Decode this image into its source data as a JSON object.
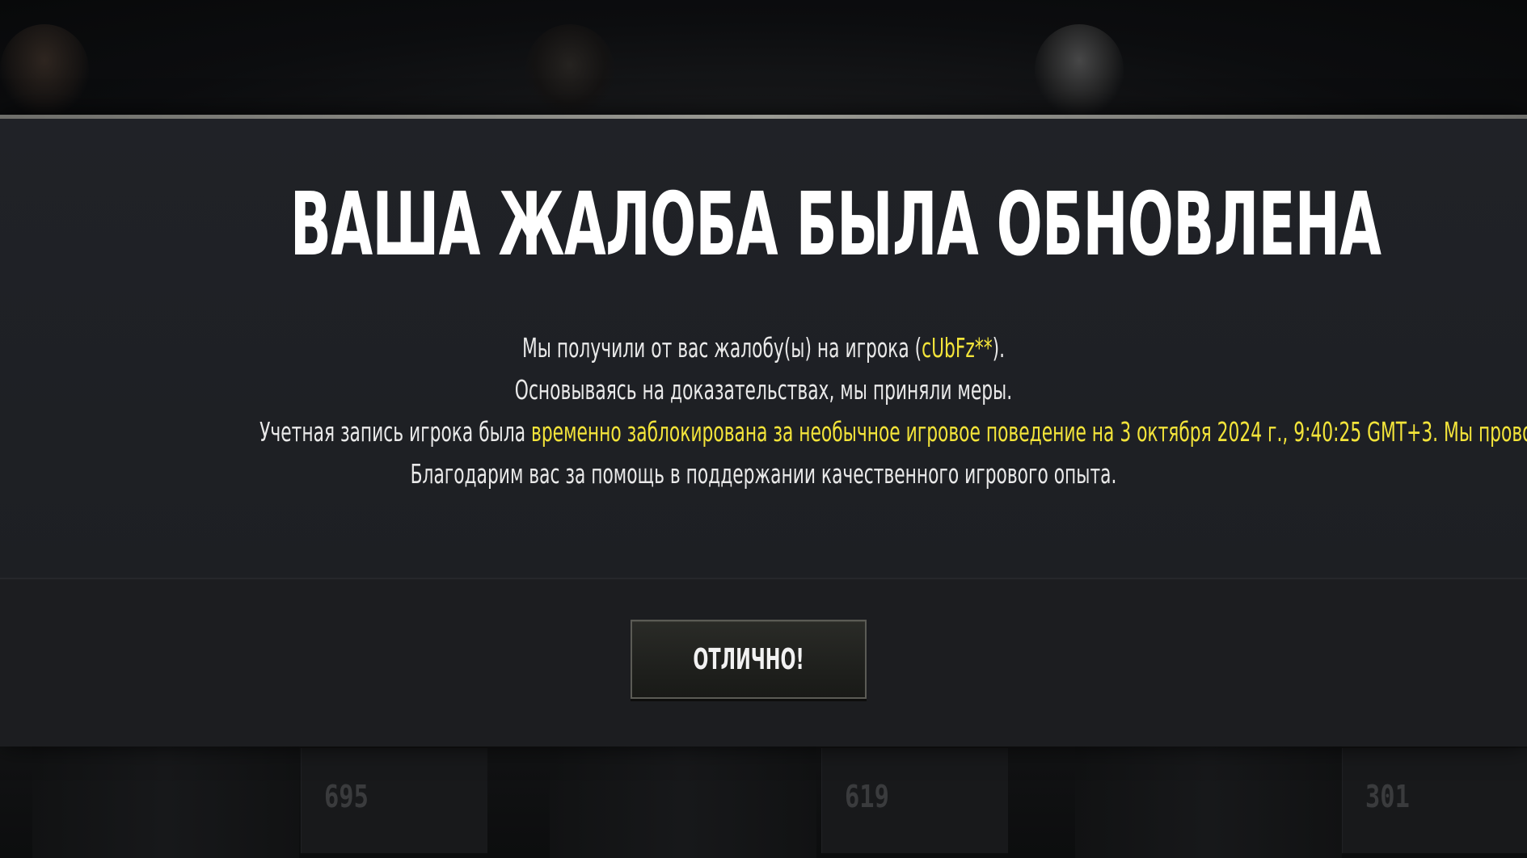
{
  "modal": {
    "title": "ВАША ЖАЛОБА БЫЛА ОБНОВЛЕНА",
    "line1_prefix": "Мы получили от вас жалобу(ы) на игрока (",
    "player_name": "cUbFz**",
    "line1_suffix": ").",
    "line2": "Основываясь на доказательствах, мы приняли меры.",
    "line3_prefix": "Учетная запись игрока была ",
    "line3_highlight": "временно заблокирована за необычное игровое поведение на 3 октября 2024 г., 9:40:25 GMT+3. Мы проводим детальное расследование.",
    "line4": "Благодарим вас за помощь в поддержании качественного игрового опыта.",
    "ok_button_label": "ОТЛИЧНО!"
  },
  "background": {
    "scores": [
      "695",
      "619",
      "301"
    ]
  },
  "colors": {
    "highlight": "#f3e43a",
    "modal_bg": "#1b1d21",
    "text": "#e9e9e9"
  }
}
